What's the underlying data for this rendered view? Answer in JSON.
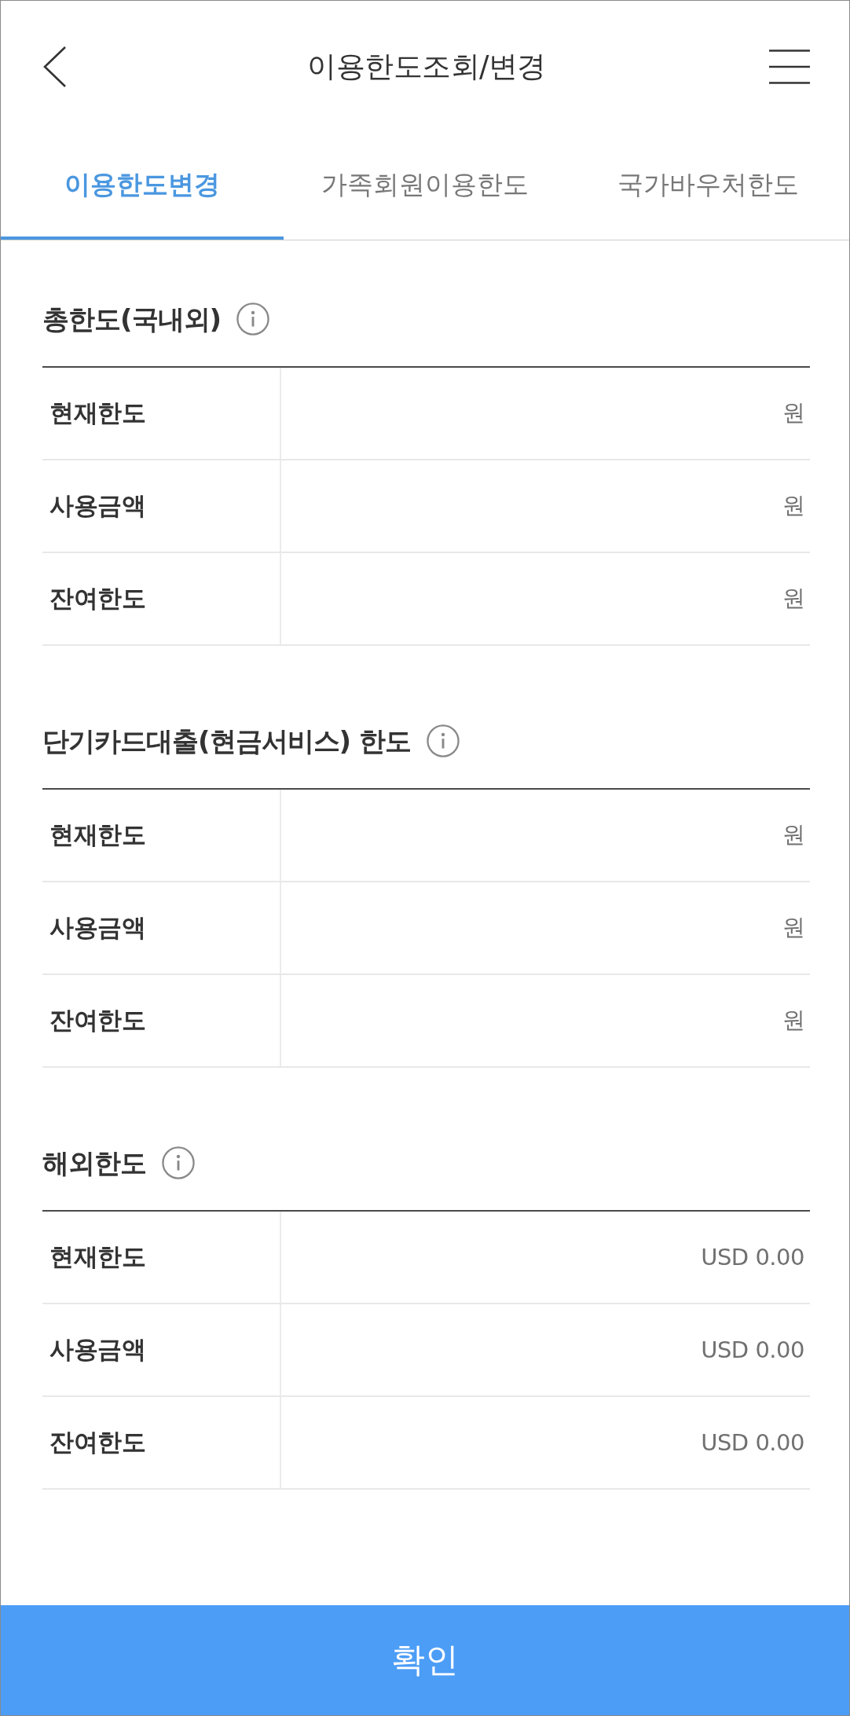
{
  "header": {
    "title": "이용한도조회/변경"
  },
  "tabs": [
    {
      "label": "이용한도변경",
      "selected": true
    },
    {
      "label": "가족회원이용한도",
      "selected": false
    },
    {
      "label": "국가바우처한도",
      "selected": false
    }
  ],
  "sections": [
    {
      "title": "총한도(국내외)",
      "rows": [
        {
          "label": "현재한도",
          "value": "원"
        },
        {
          "label": "사용금액",
          "value": "원"
        },
        {
          "label": "잔여한도",
          "value": "원"
        }
      ]
    },
    {
      "title": "단기카드대출(현금서비스) 한도",
      "rows": [
        {
          "label": "현재한도",
          "value": "원"
        },
        {
          "label": "사용금액",
          "value": "원"
        },
        {
          "label": "잔여한도",
          "value": "원"
        }
      ]
    },
    {
      "title": "해외한도",
      "rows": [
        {
          "label": "현재한도",
          "value": "USD 0.00"
        },
        {
          "label": "사용금액",
          "value": "USD 0.00"
        },
        {
          "label": "잔여한도",
          "value": "USD 0.00"
        }
      ]
    }
  ],
  "confirm_button": {
    "label": "확인"
  }
}
